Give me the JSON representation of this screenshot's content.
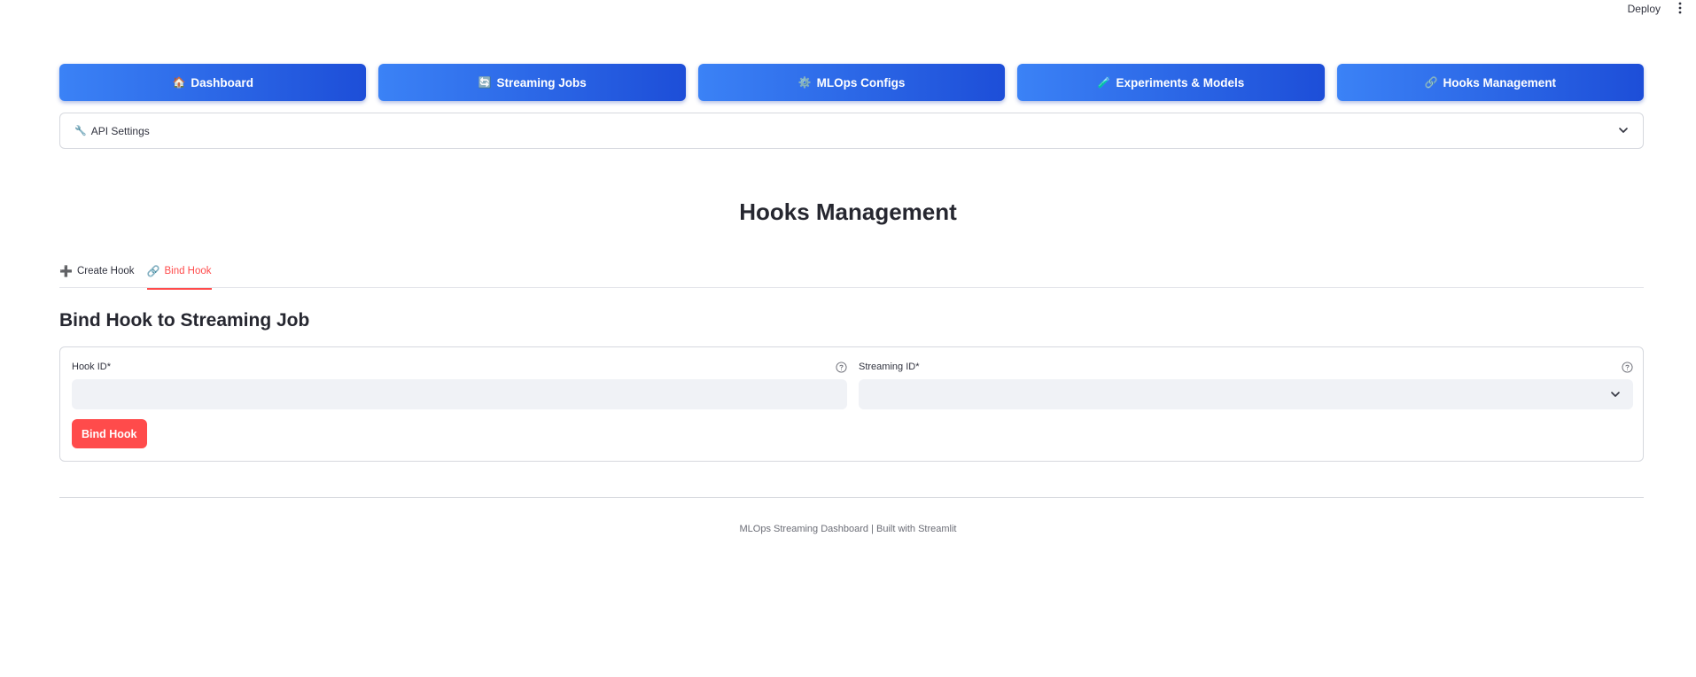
{
  "header": {
    "deploy_label": "Deploy",
    "menu_icon": "vertical-dots-icon"
  },
  "nav": {
    "buttons": [
      {
        "label": "Dashboard",
        "icon": "🏠"
      },
      {
        "label": "Streaming Jobs",
        "icon": "🔄"
      },
      {
        "label": "MLOps Configs",
        "icon": "⚙️"
      },
      {
        "label": "Experiments & Models",
        "icon": "🧪"
      },
      {
        "label": "Hooks Management",
        "icon": "🔗"
      }
    ],
    "colors": {
      "start": "#3b82f6",
      "end": "#1d4ed8",
      "text": "#ffffff"
    }
  },
  "expander": {
    "label": "API Settings",
    "icon": "🔧",
    "expanded": false
  },
  "page": {
    "title": "Hooks Management"
  },
  "tabs": [
    {
      "label": "Create Hook",
      "icon": "➕",
      "active": false
    },
    {
      "label": "Bind Hook",
      "icon": "🔗",
      "active": true
    }
  ],
  "form": {
    "title": "Bind Hook to Streaming Job",
    "hook_id": {
      "label": "Hook ID*",
      "value": "",
      "placeholder": ""
    },
    "streaming_id": {
      "label": "Streaming ID*",
      "selected": ""
    },
    "submit_label": "Bind Hook",
    "accent_color": "#ff4b4b"
  },
  "footer": {
    "text": "MLOps Streaming Dashboard | Built with Streamlit"
  }
}
